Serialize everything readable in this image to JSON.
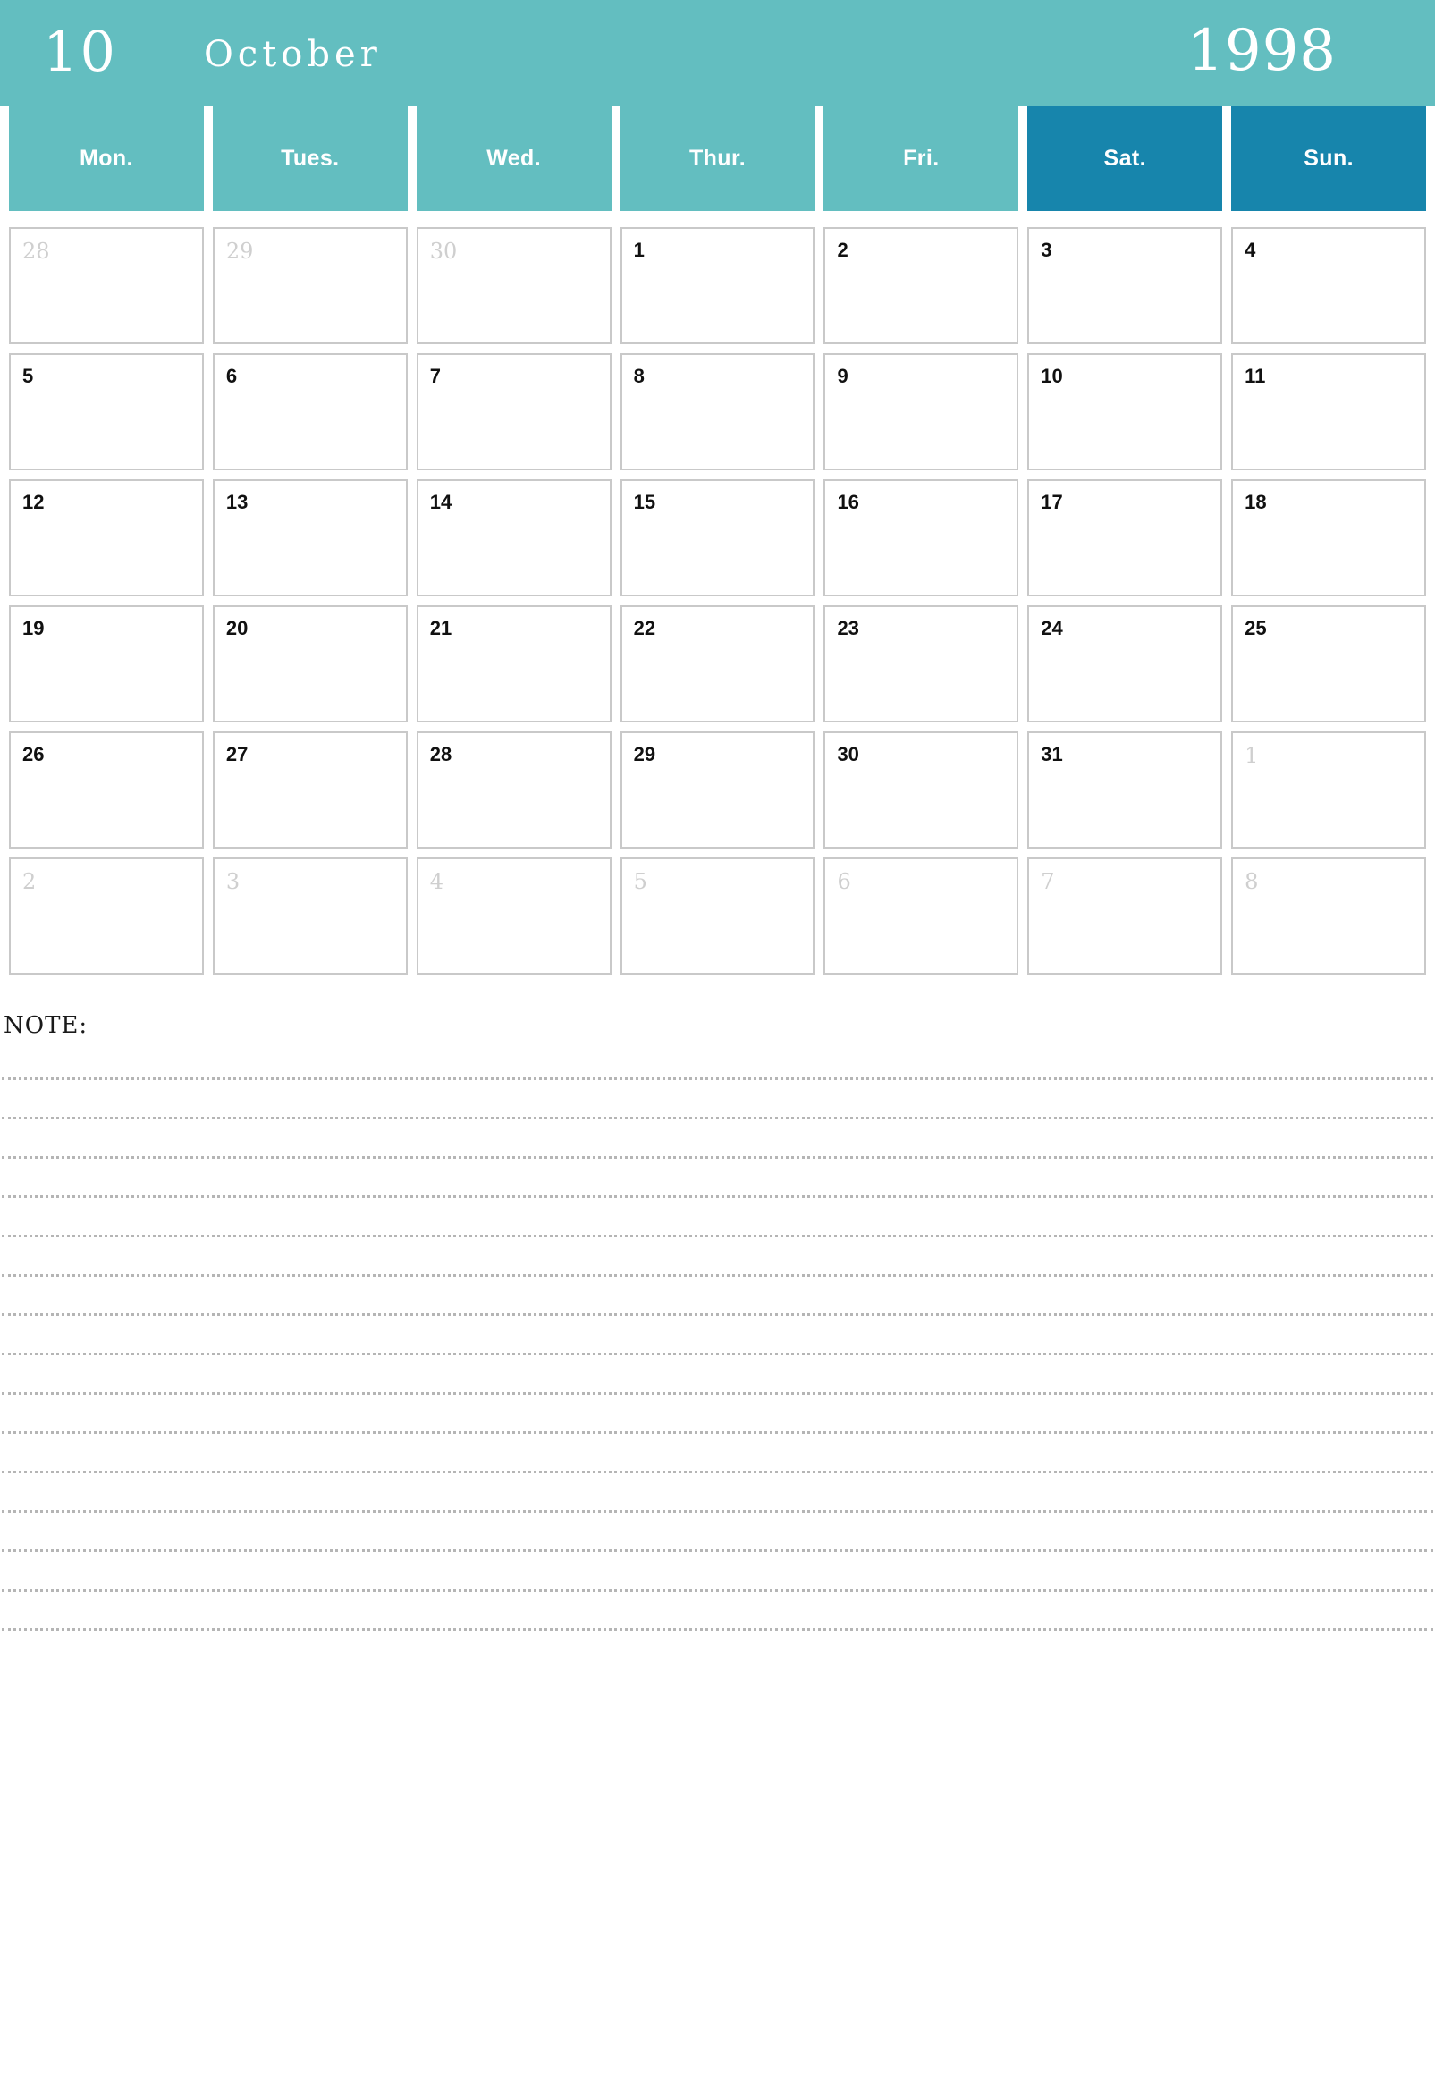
{
  "header": {
    "month_number": "10",
    "month_name": "October",
    "year": "1998"
  },
  "colors": {
    "accent_teal": "#63bec0",
    "accent_blue": "#1785ac",
    "cell_border": "#c9c9c9",
    "muted_text": "#cfcfcf",
    "text": "#111111"
  },
  "weekdays": [
    {
      "label": "Mon.",
      "weekend": false
    },
    {
      "label": "Tues.",
      "weekend": false
    },
    {
      "label": "Wed.",
      "weekend": false
    },
    {
      "label": "Thur.",
      "weekend": false
    },
    {
      "label": "Fri.",
      "weekend": false
    },
    {
      "label": "Sat.",
      "weekend": true
    },
    {
      "label": "Sun.",
      "weekend": true
    }
  ],
  "weeks": [
    [
      {
        "day": "28",
        "muted": true
      },
      {
        "day": "29",
        "muted": true
      },
      {
        "day": "30",
        "muted": true
      },
      {
        "day": "1",
        "muted": false
      },
      {
        "day": "2",
        "muted": false
      },
      {
        "day": "3",
        "muted": false
      },
      {
        "day": "4",
        "muted": false
      }
    ],
    [
      {
        "day": "5",
        "muted": false
      },
      {
        "day": "6",
        "muted": false
      },
      {
        "day": "7",
        "muted": false
      },
      {
        "day": "8",
        "muted": false
      },
      {
        "day": "9",
        "muted": false
      },
      {
        "day": "10",
        "muted": false
      },
      {
        "day": "11",
        "muted": false
      }
    ],
    [
      {
        "day": "12",
        "muted": false
      },
      {
        "day": "13",
        "muted": false
      },
      {
        "day": "14",
        "muted": false
      },
      {
        "day": "15",
        "muted": false
      },
      {
        "day": "16",
        "muted": false
      },
      {
        "day": "17",
        "muted": false
      },
      {
        "day": "18",
        "muted": false
      }
    ],
    [
      {
        "day": "19",
        "muted": false
      },
      {
        "day": "20",
        "muted": false
      },
      {
        "day": "21",
        "muted": false
      },
      {
        "day": "22",
        "muted": false
      },
      {
        "day": "23",
        "muted": false
      },
      {
        "day": "24",
        "muted": false
      },
      {
        "day": "25",
        "muted": false
      }
    ],
    [
      {
        "day": "26",
        "muted": false
      },
      {
        "day": "27",
        "muted": false
      },
      {
        "day": "28",
        "muted": false
      },
      {
        "day": "29",
        "muted": false
      },
      {
        "day": "30",
        "muted": false
      },
      {
        "day": "31",
        "muted": false
      },
      {
        "day": "1",
        "muted": true
      }
    ],
    [
      {
        "day": "2",
        "muted": true
      },
      {
        "day": "3",
        "muted": true
      },
      {
        "day": "4",
        "muted": true
      },
      {
        "day": "5",
        "muted": true
      },
      {
        "day": "6",
        "muted": true
      },
      {
        "day": "7",
        "muted": true
      },
      {
        "day": "8",
        "muted": true
      }
    ]
  ],
  "note": {
    "label": "NOTE:",
    "line_count": 15
  }
}
